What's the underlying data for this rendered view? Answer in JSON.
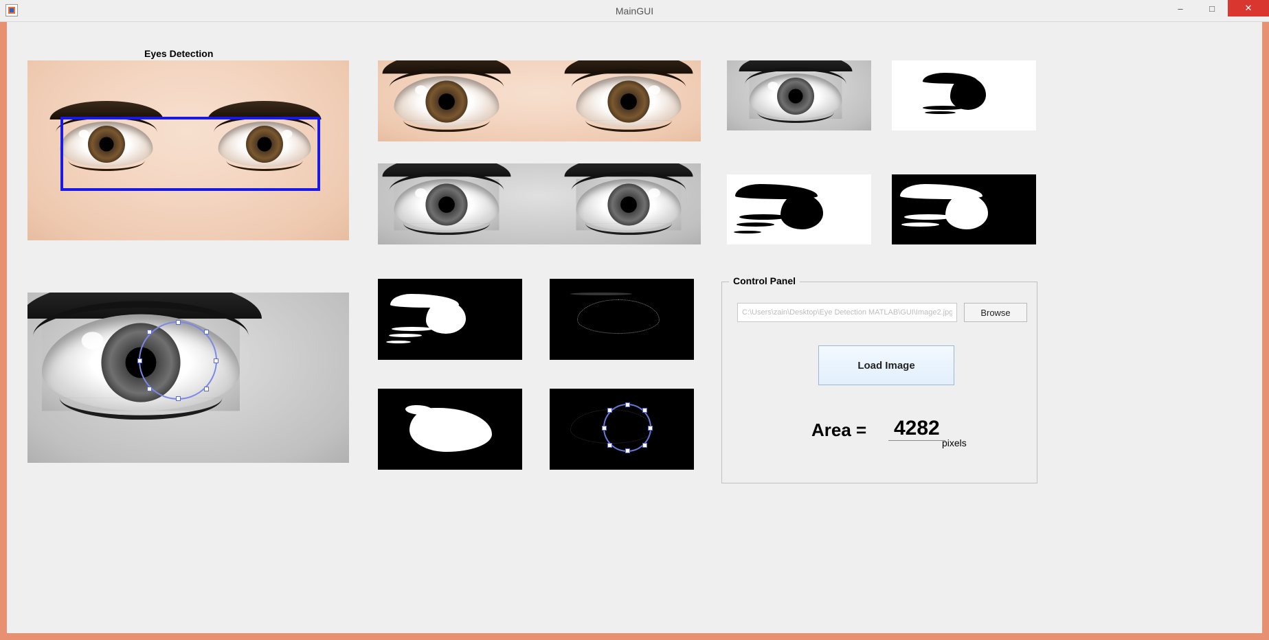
{
  "window": {
    "title": "MainGUI",
    "minimize_label": "–",
    "maximize_label": "□",
    "close_label": "✕"
  },
  "panels": {
    "eyes_detection_title": "Eyes Detection"
  },
  "control_panel": {
    "legend": "Control Panel",
    "path_value": "C:\\Users\\zain\\Desktop\\Eye Detection MATLAB\\GUI\\Image2.jpg",
    "browse_label": "Browse",
    "load_label": "Load Image",
    "area_label": "Area  =",
    "area_value": "4282",
    "area_unit": "pixels"
  }
}
